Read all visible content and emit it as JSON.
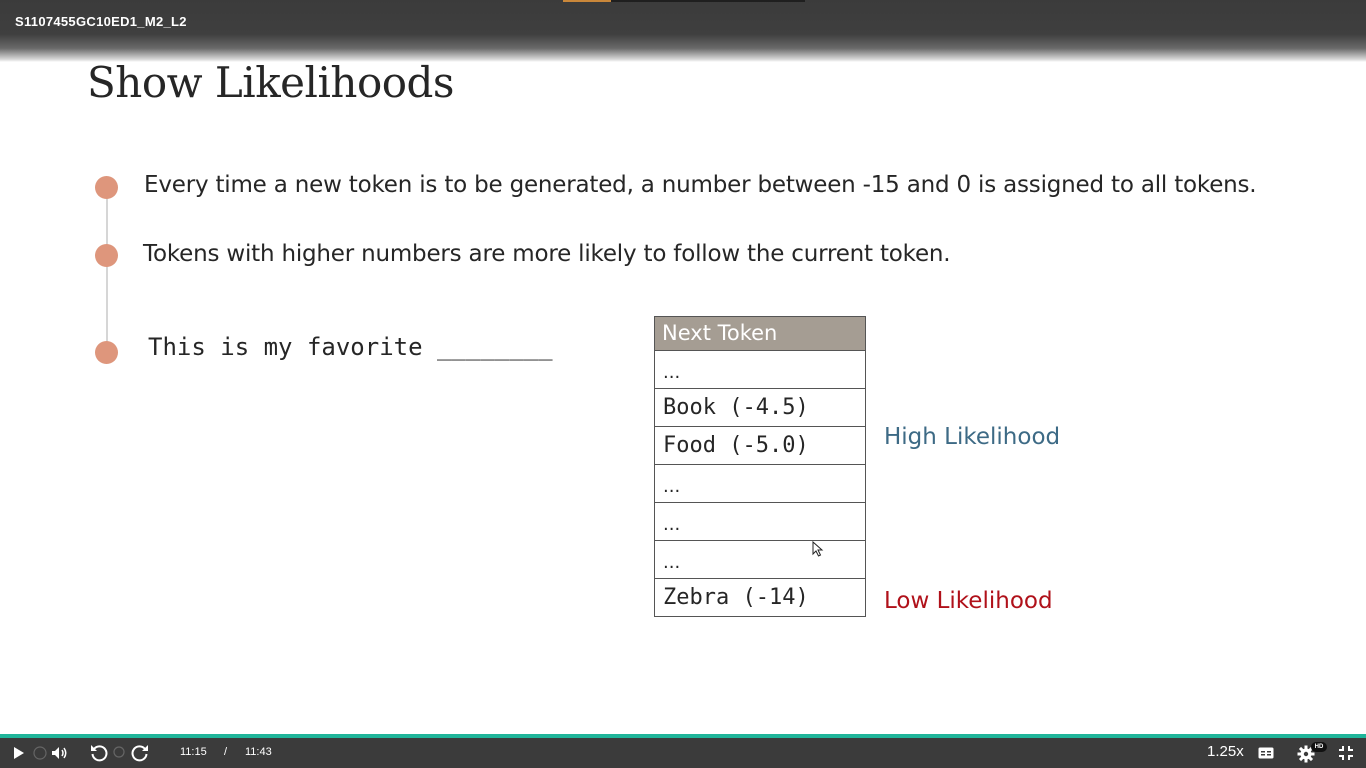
{
  "window": {
    "title": "S1107455GC10ED1_M2_L2"
  },
  "slide": {
    "title": "Show Likelihoods",
    "bullets": [
      "Every time a new token is to be generated, a number between -15 and 0 is assigned to all tokens.",
      "Tokens with higher numbers are more likely to follow the current token."
    ],
    "example_text": "This is my favorite ________",
    "table": {
      "header": "Next Token",
      "rows": [
        "...",
        "Book (-4.5)",
        "Food (-5.0)",
        "...",
        "...",
        "...",
        "Zebra (-14)"
      ]
    },
    "labels": {
      "high": "High Likelihood",
      "low": "Low Likelihood"
    },
    "colors": {
      "bullet_dot": "#de967c",
      "table_header": "#a59d93",
      "high_label": "#3d6a85",
      "low_label": "#b0111a",
      "progress": "#1fb59a"
    }
  },
  "player": {
    "current_time": "11:15",
    "separator": "/",
    "duration": "11:43",
    "speed": "1.25x",
    "quality_badge": "HD",
    "progress_fraction": 0.96,
    "icons": [
      "play-icon",
      "volume-icon",
      "rewind-icon",
      "forward-icon",
      "captions-icon",
      "gear-icon",
      "exit-fullscreen-icon"
    ]
  }
}
